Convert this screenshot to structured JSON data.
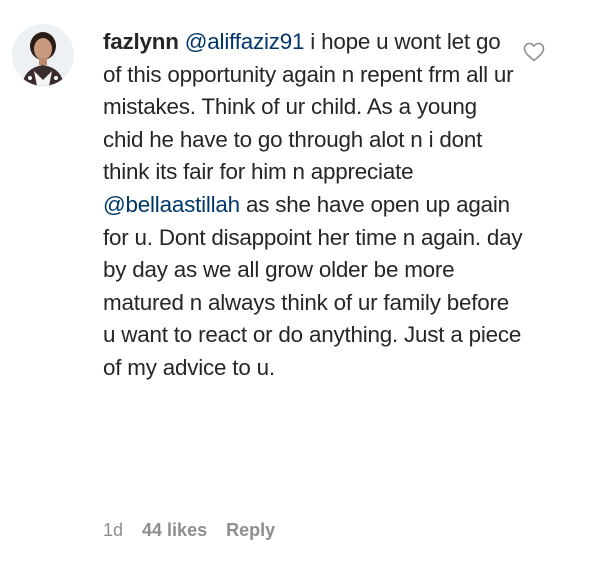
{
  "comment": {
    "username": "fazlynn",
    "segments": [
      {
        "type": "mention",
        "text": "@aliffaziz91"
      },
      {
        "type": "text",
        "text": " i hope u wont let go of this opportunity again n repent frm all ur mistakes. Think of ur child. As a young chid he have to go through alot n i dont think its fair for him n appreciate "
      },
      {
        "type": "mention",
        "text": "@bellaastillah"
      },
      {
        "type": "text",
        "text": " as she have open up again for u. Dont disappoint her time n again. day by day as we all grow older be more matured n always think of ur family before u want to react or do anything. Just a piece of my advice to u."
      }
    ],
    "timestamp": "1d",
    "likes": "44 likes",
    "reply_label": "Reply"
  },
  "icons": {
    "like": "heart-outline-icon",
    "avatar": "profile-avatar"
  },
  "colors": {
    "text": "#262626",
    "mention": "#00376b",
    "meta": "#8e8e8e"
  }
}
